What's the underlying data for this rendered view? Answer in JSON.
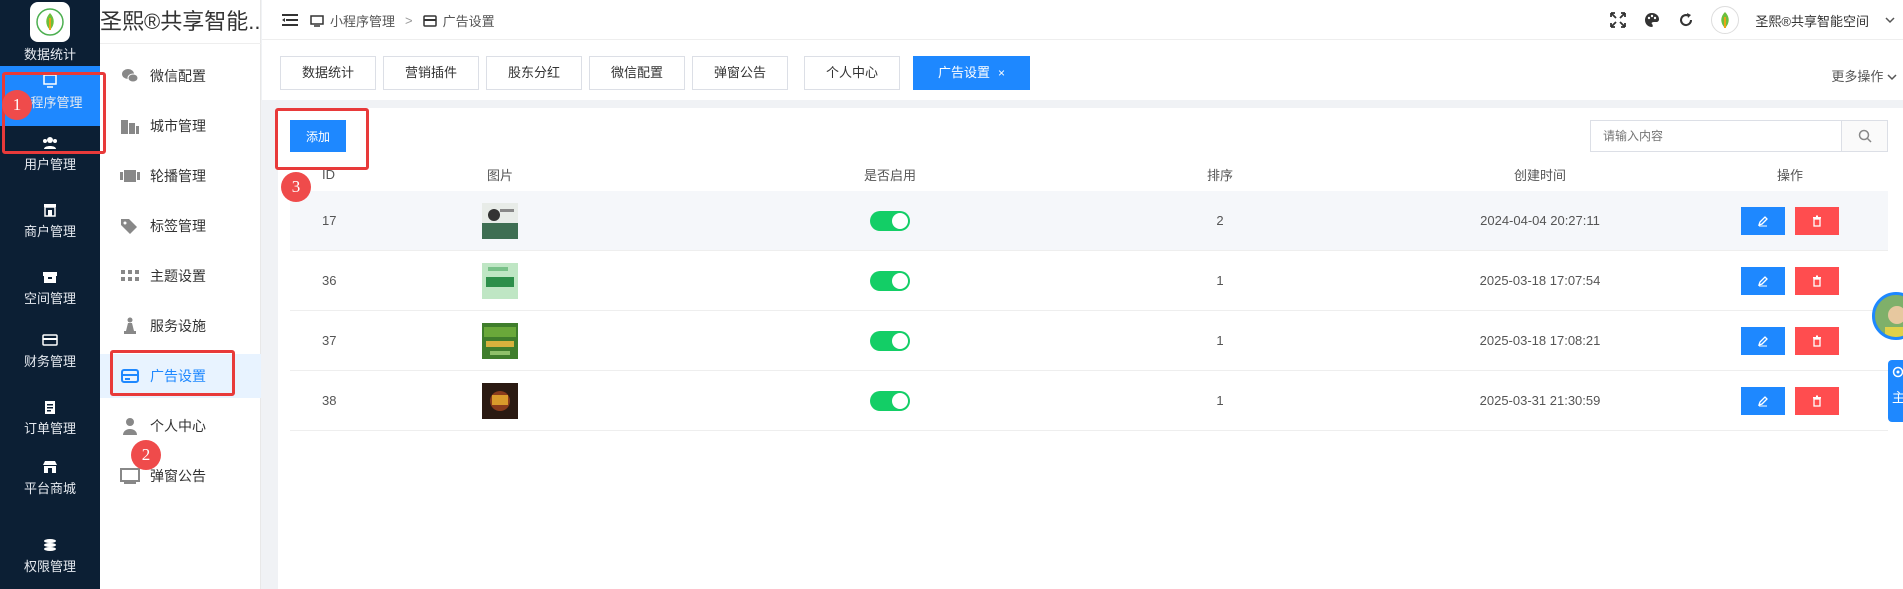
{
  "nav": {
    "top_label": "数据统计",
    "items": [
      {
        "label": "小程序管理",
        "icon": "monitor-icon",
        "active": true
      },
      {
        "label": "用户管理",
        "icon": "users-icon"
      },
      {
        "label": "商户管理",
        "icon": "shop-icon"
      },
      {
        "label": "空间管理",
        "icon": "box-icon"
      },
      {
        "label": "财务管理",
        "icon": "card-icon"
      },
      {
        "label": "订单管理",
        "icon": "clipboard-icon"
      },
      {
        "label": "平台商城",
        "icon": "store-icon"
      },
      {
        "label": "权限管理",
        "icon": "coins-icon"
      }
    ]
  },
  "subnav": {
    "title": "圣熙®共享智能...",
    "items": [
      {
        "label": "微信配置",
        "icon": "wechat-icon"
      },
      {
        "label": "城市管理",
        "icon": "building-icon"
      },
      {
        "label": "轮播管理",
        "icon": "carousel-icon"
      },
      {
        "label": "标签管理",
        "icon": "tag-icon"
      },
      {
        "label": "主题设置",
        "icon": "grid-icon"
      },
      {
        "label": "服务设施",
        "icon": "chess-icon"
      },
      {
        "label": "广告设置",
        "icon": "ad-icon",
        "active": true
      },
      {
        "label": "个人中心",
        "icon": "person-icon"
      },
      {
        "label": "弹窗公告",
        "icon": "monitor-icon"
      }
    ]
  },
  "header": {
    "breadcrumb": [
      "小程序管理",
      "广告设置"
    ],
    "separator": ">",
    "user_name": "圣熙®共享智能空间"
  },
  "tabs": {
    "items": [
      "数据统计",
      "营销插件",
      "股东分红",
      "微信配置",
      "弹窗公告",
      "个人中心",
      "广告设置"
    ],
    "active_index": 6,
    "close_glyph": "×",
    "more_ops": "更多操作"
  },
  "main": {
    "add_label": "添加",
    "search_placeholder": "请输入内容",
    "columns": [
      "ID",
      "图片",
      "是否启用",
      "排序",
      "创建时间",
      "操作"
    ],
    "rows": [
      {
        "id": "17",
        "enabled": true,
        "sort": "2",
        "created": "2024-04-04 20:27:11"
      },
      {
        "id": "36",
        "enabled": true,
        "sort": "1",
        "created": "2025-03-18 17:07:54"
      },
      {
        "id": "37",
        "enabled": true,
        "sort": "1",
        "created": "2025-03-18 17:08:21"
      },
      {
        "id": "38",
        "enabled": true,
        "sort": "1",
        "created": "2025-03-31 21:30:59"
      }
    ]
  },
  "annotations": [
    "1",
    "2",
    "3"
  ],
  "float_tab_label": "主",
  "colors": {
    "accent": "#1e88ff",
    "nav_bg": "#0c1f34",
    "danger": "#ff4d4f",
    "switch_on": "#13ce66",
    "annotation": "#e83a3a"
  }
}
